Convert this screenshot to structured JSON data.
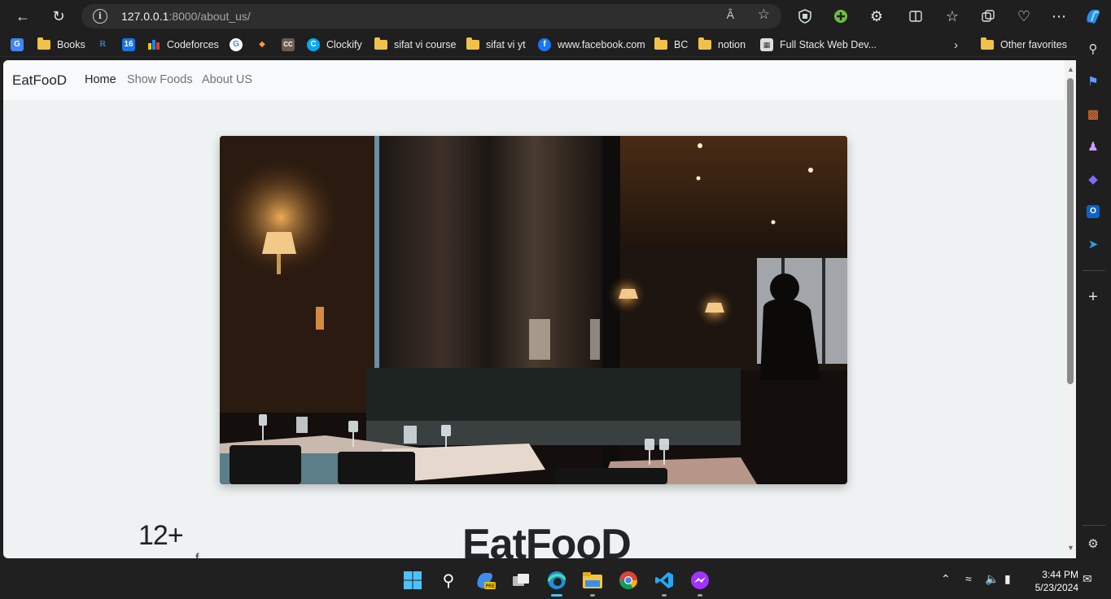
{
  "browser": {
    "url_host": "127.0.0.1",
    "url_rest": ":8000/about_us/"
  },
  "favorites": [
    {
      "label": "",
      "kind": "google-translate"
    },
    {
      "label": "Books",
      "kind": "folder"
    },
    {
      "label": "",
      "kind": "site"
    },
    {
      "label": "",
      "kind": "calendar"
    },
    {
      "label": "Codeforces",
      "kind": "site"
    },
    {
      "label": "",
      "kind": "google"
    },
    {
      "label": "",
      "kind": "site"
    },
    {
      "label": "",
      "kind": "site"
    },
    {
      "label": "Clockify",
      "kind": "site"
    },
    {
      "label": "sifat vi course",
      "kind": "folder"
    },
    {
      "label": "sifat vi yt",
      "kind": "folder"
    },
    {
      "label": "www.facebook.com",
      "kind": "facebook"
    },
    {
      "label": "BC",
      "kind": "folder"
    },
    {
      "label": "notion",
      "kind": "folder"
    },
    {
      "label": "Full Stack Web Dev...",
      "kind": "site"
    },
    {
      "label": "Other favorites",
      "kind": "folder"
    }
  ],
  "navbar": {
    "brand": "EatFooD",
    "links": [
      "Home",
      "Show Foods",
      "About US"
    ]
  },
  "content": {
    "stat_number": "12+",
    "stat_label": "f",
    "title": "EatFooD"
  },
  "taskbar": {
    "time": "3:44 PM",
    "date": "5/23/2024"
  },
  "colors": {
    "page_bg": "#eef2f2",
    "navbar_bg": "#f8f9fa",
    "chrome_bg": "#1f1f1f"
  }
}
